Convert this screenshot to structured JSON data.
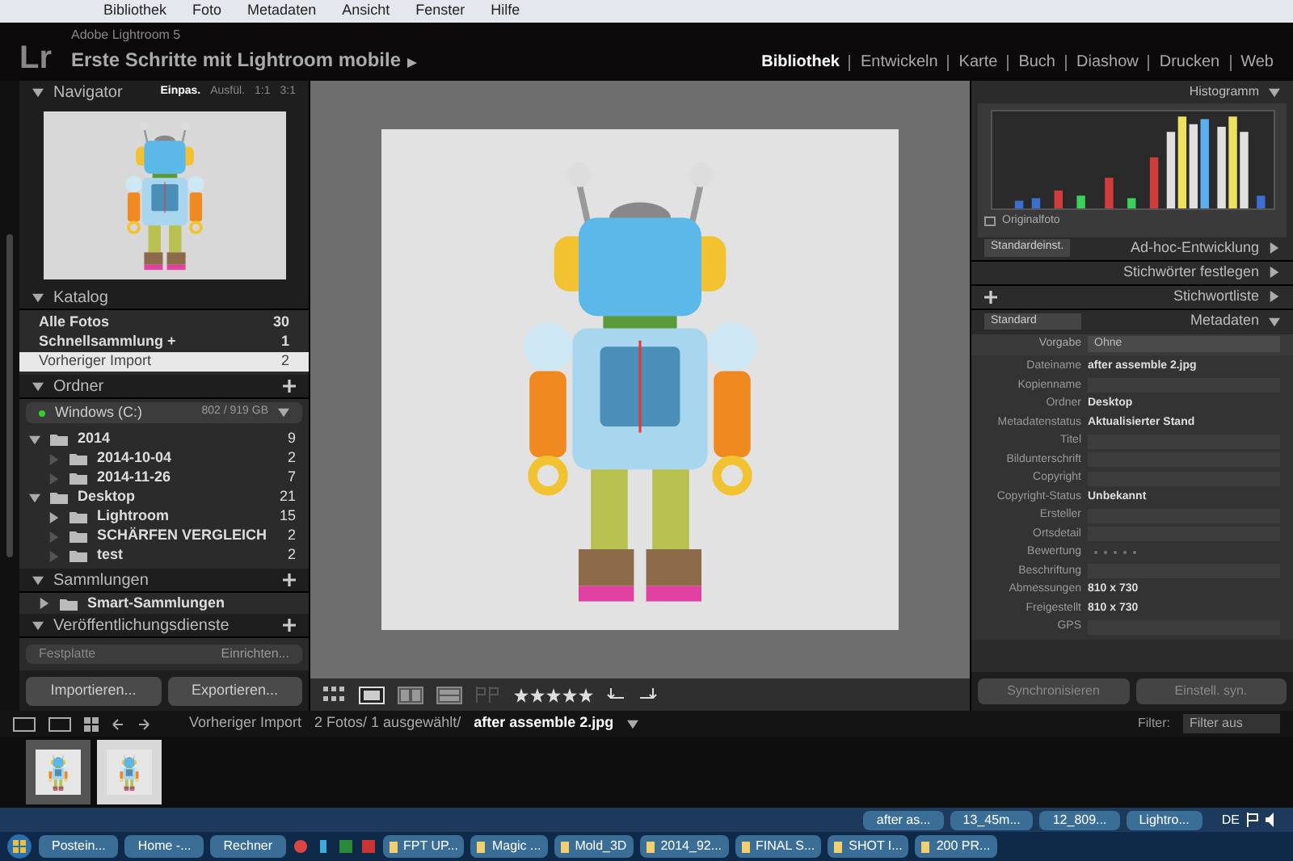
{
  "menu_bar": [
    "Bibliothek",
    "Foto",
    "Metadaten",
    "Ansicht",
    "Fenster",
    "Hilfe"
  ],
  "identity": {
    "logo": "Lr",
    "product": "Adobe Lightroom 5",
    "title": "Erste Schritte mit Lightroom mobile"
  },
  "modules": [
    {
      "label": "Bibliothek",
      "selected": true
    },
    {
      "label": "Entwickeln",
      "selected": false
    },
    {
      "label": "Karte",
      "selected": false
    },
    {
      "label": "Buch",
      "selected": false
    },
    {
      "label": "Diashow",
      "selected": false
    },
    {
      "label": "Drucken",
      "selected": false
    },
    {
      "label": "Web",
      "selected": false
    }
  ],
  "navigator": {
    "title": "Navigator",
    "zoom_options": [
      {
        "label": "Einpas.",
        "selected": true
      },
      {
        "label": "Ausfül.",
        "selected": false
      },
      {
        "label": "1:1",
        "selected": false
      },
      {
        "label": "3:1",
        "selected": false
      }
    ]
  },
  "catalog": {
    "title": "Katalog",
    "items": [
      {
        "label": "Alle Fotos",
        "count": "30",
        "selected": false
      },
      {
        "label": "Schnellsammlung +",
        "count": "1",
        "selected": false
      },
      {
        "label": "Vorheriger Import",
        "count": "2",
        "selected": true
      }
    ]
  },
  "folders": {
    "title": "Ordner",
    "volume": {
      "name": "Windows (C:)",
      "space": "802 / 919 GB"
    },
    "tree": [
      {
        "label": "2014",
        "count": "9",
        "expanded": true,
        "children": [
          {
            "label": "2014-10-04",
            "count": "2"
          },
          {
            "label": "2014-11-26",
            "count": "7"
          }
        ]
      },
      {
        "label": "Desktop",
        "count": "21",
        "expanded": true,
        "children": [
          {
            "label": "Lightroom",
            "count": "15",
            "expanded": false
          },
          {
            "label": "SCHÄRFEN VERGLEICH",
            "count": "2"
          },
          {
            "label": "test",
            "count": "2"
          }
        ]
      }
    ]
  },
  "collections": {
    "title": "Sammlungen",
    "items": [
      {
        "label": "Smart-Sammlungen",
        "expanded": false
      }
    ]
  },
  "publish": {
    "title": "Veröffentlichungsdienste",
    "services": [
      {
        "label": "Festplatte",
        "action": "Einrichten..."
      }
    ]
  },
  "import_button": "Importieren...",
  "export_button": "Exportieren...",
  "toolbar": {
    "stars": 5
  },
  "histogram": {
    "title": "Histogramm",
    "original_photo": "Originalfoto"
  },
  "sections": [
    {
      "title": "Ad-hoc-Entwicklung",
      "preset": "Standardeinst."
    },
    {
      "title": "Stichwörter festlegen"
    },
    {
      "title": "Stichwortliste"
    }
  ],
  "metadata": {
    "title": "Metadaten",
    "preset": "Standard",
    "preset_label": "Vorgabe",
    "preset_value": "Ohne",
    "fields": [
      {
        "label": "Dateiname",
        "value": "after assemble 2.jpg"
      },
      {
        "label": "Kopienname"
      },
      {
        "label": "Ordner",
        "value": "Desktop"
      },
      {
        "label": "Metadatenstatus",
        "value": "Aktualisierter Stand"
      },
      {
        "label": "Titel"
      },
      {
        "label": "Bildunterschrift"
      },
      {
        "label": "Copyright"
      },
      {
        "label": "Copyright-Status",
        "value": "Unbekannt"
      },
      {
        "label": "Ersteller"
      },
      {
        "label": "Ortsdetail"
      },
      {
        "label": "Bewertung",
        "kind": "rating",
        "stars": 0
      },
      {
        "label": "Beschriftung"
      },
      {
        "label": "Abmessungen",
        "value": "810 x 730"
      },
      {
        "label": "Freigestellt",
        "value": "810 x 730"
      },
      {
        "label": "GPS"
      }
    ]
  },
  "sync_buttons": [
    "Synchronisieren",
    "Einstell. syn."
  ],
  "filmstrip": {
    "source": "Vorheriger Import",
    "summary": "2 Fotos/ 1 ausgewählt/",
    "file": "after assemble 2.jpg",
    "filter_label": "Filter:",
    "filter_value": "Filter aus",
    "thumbnails": [
      {
        "selected": false
      },
      {
        "selected": true
      }
    ]
  },
  "taskbar": {
    "top_windows": [
      "after as...",
      "13_45m...",
      "12_809...",
      "Lightro..."
    ],
    "language": "DE",
    "pinned": [
      "Postein...",
      "Home -...",
      "Rechner"
    ],
    "windows": [
      "FPT UP...",
      "Magic ...",
      "Mold_3D",
      "2014_92...",
      "FINAL S...",
      "SHOT I...",
      "200 PR..."
    ]
  }
}
